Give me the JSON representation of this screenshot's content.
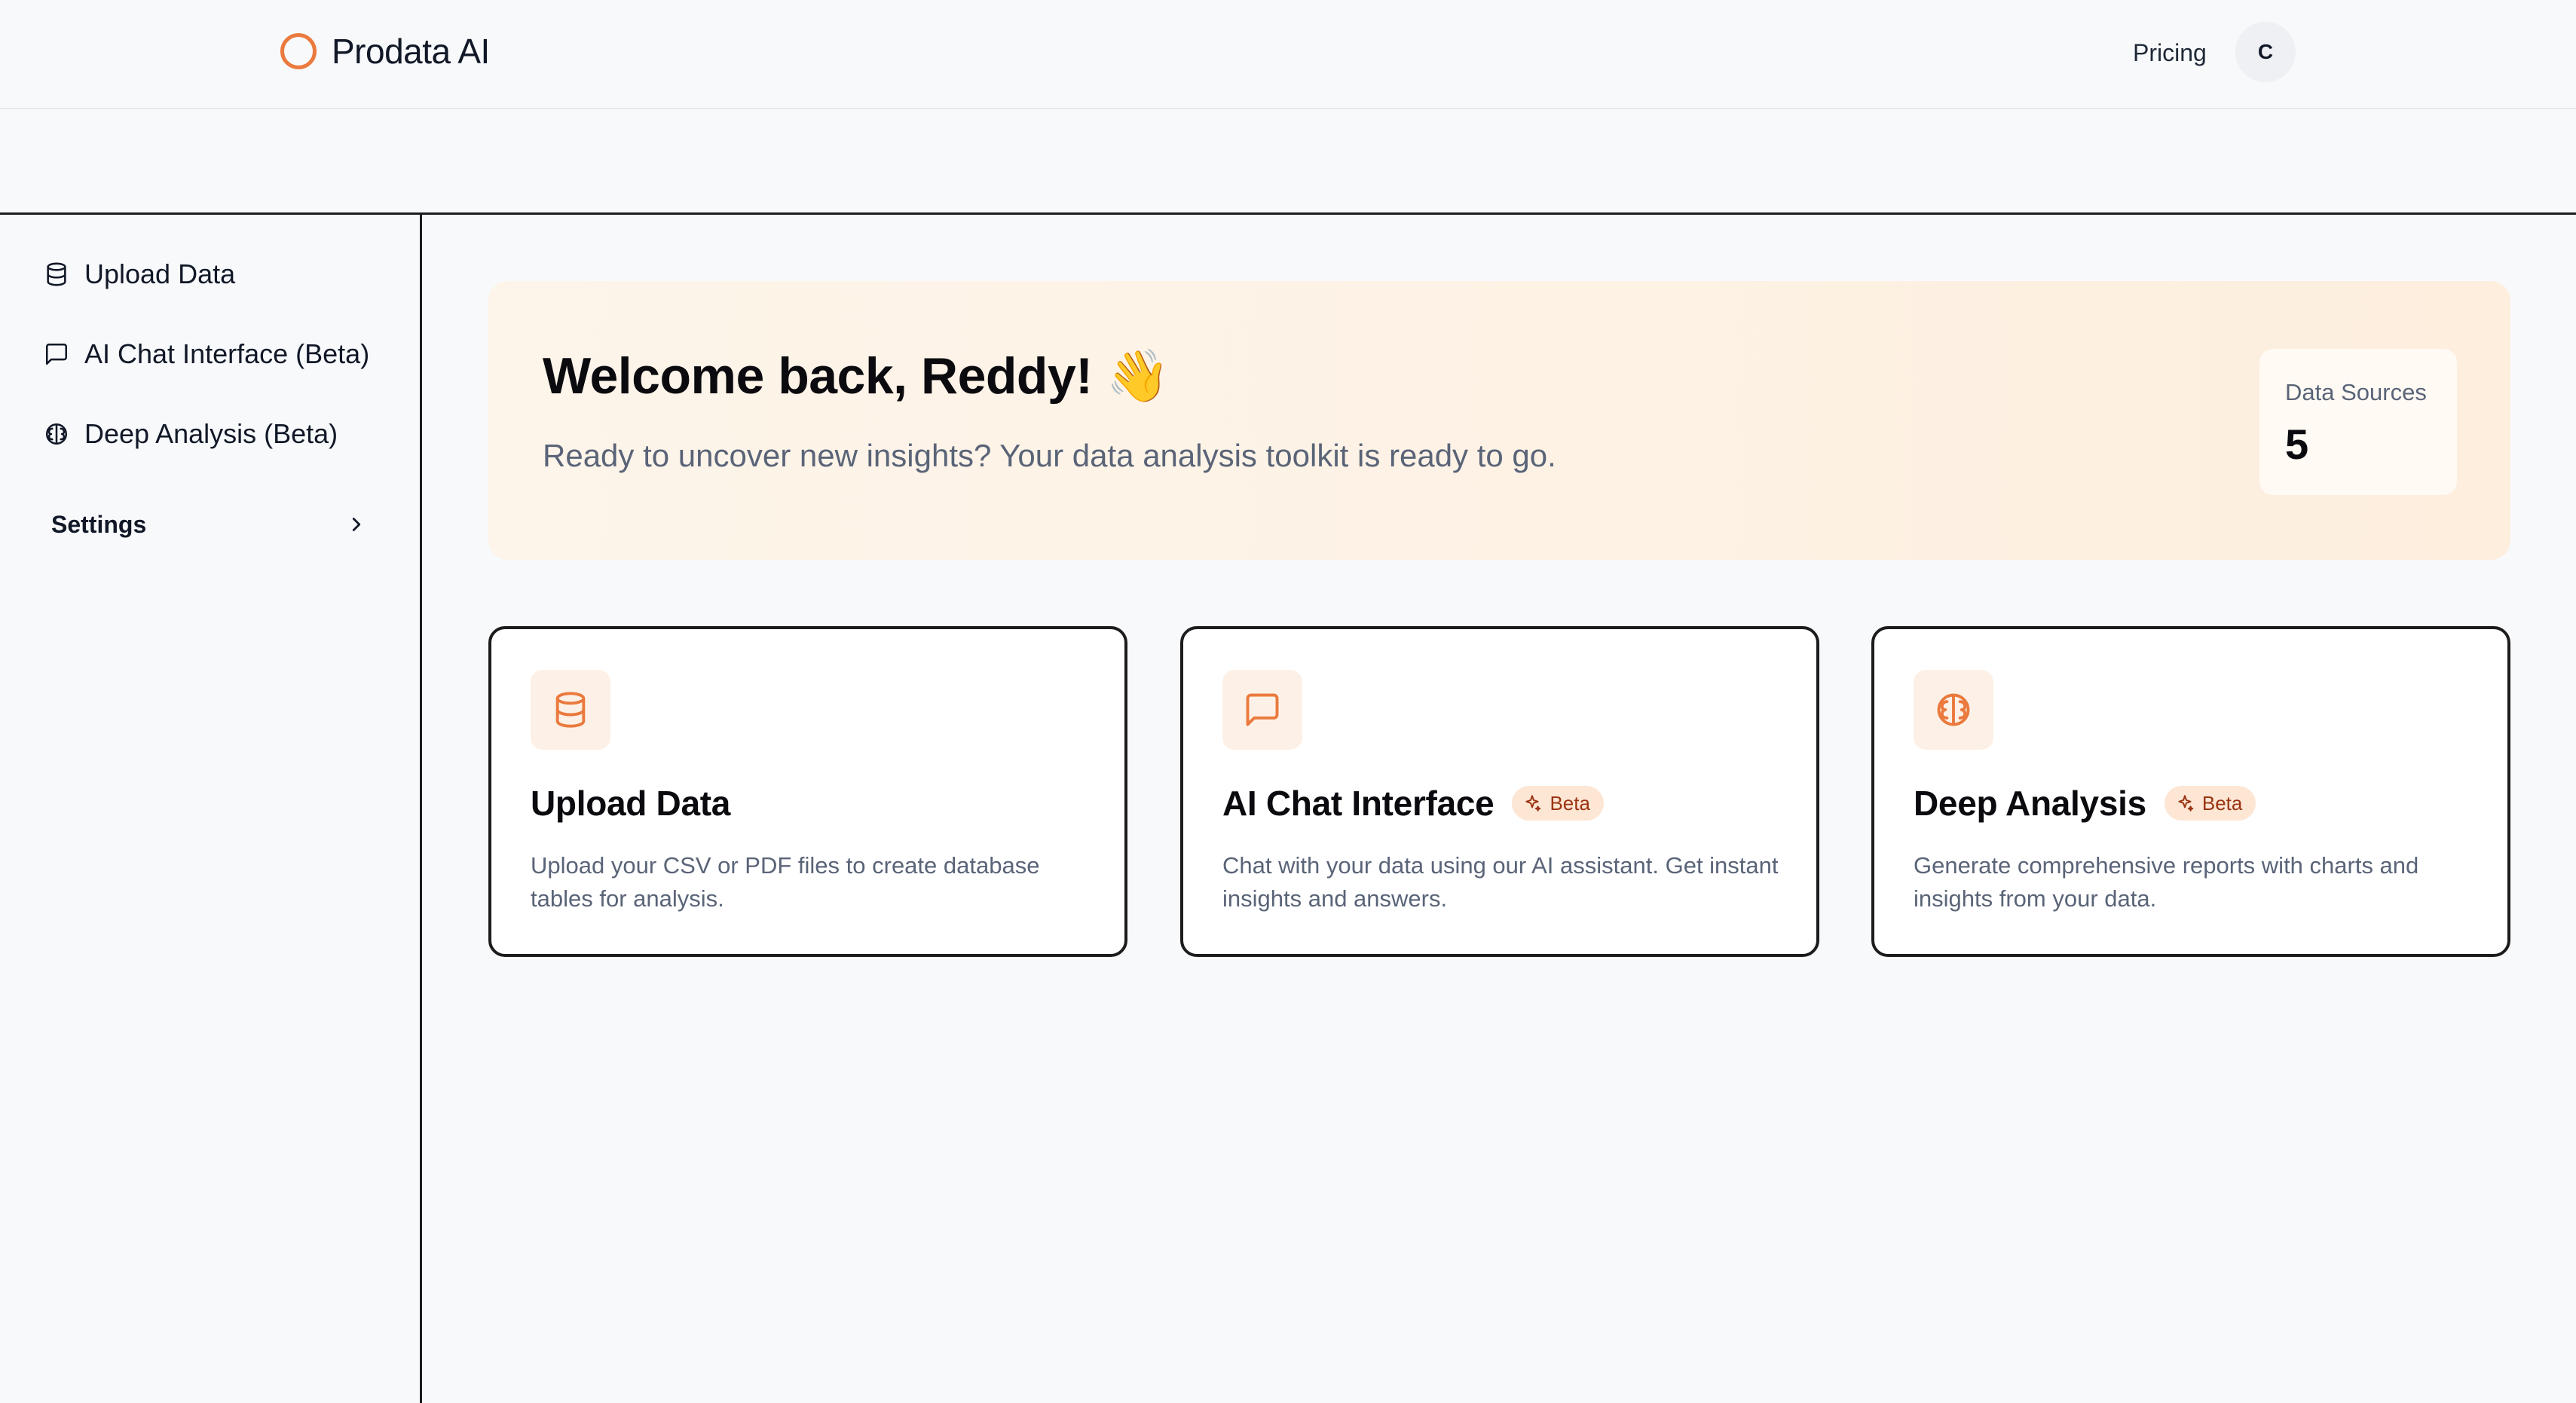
{
  "header": {
    "brand": "Prodata AI",
    "pricing_label": "Pricing",
    "avatar_initial": "C"
  },
  "sidebar": {
    "items": [
      {
        "label": "Upload Data",
        "icon": "database-icon"
      },
      {
        "label": "AI Chat Interface (Beta)",
        "icon": "message-square-icon"
      },
      {
        "label": "Deep Analysis (Beta)",
        "icon": "brain-icon"
      }
    ],
    "settings_label": "Settings"
  },
  "banner": {
    "title": "Welcome back, Reddy! 👋",
    "subtitle": "Ready to uncover new insights? Your data analysis toolkit is ready to go.",
    "stat_label": "Data Sources",
    "stat_value": "5"
  },
  "cards": [
    {
      "title": "Upload Data",
      "description": "Upload your CSV or PDF files to create database tables for analysis.",
      "icon": "database-icon"
    },
    {
      "title": "AI Chat Interface",
      "badge": "Beta",
      "description": "Chat with your data using our AI assistant. Get instant insights and answers.",
      "icon": "message-square-icon"
    },
    {
      "title": "Deep Analysis",
      "badge": "Beta",
      "description": "Generate comprehensive reports with charts and insights from your data.",
      "icon": "brain-icon"
    }
  ],
  "colors": {
    "accent": "#ea7a3d",
    "banner_bg": "#fdf2e4",
    "badge_bg": "#fde6d4",
    "badge_text": "#9a3412"
  }
}
